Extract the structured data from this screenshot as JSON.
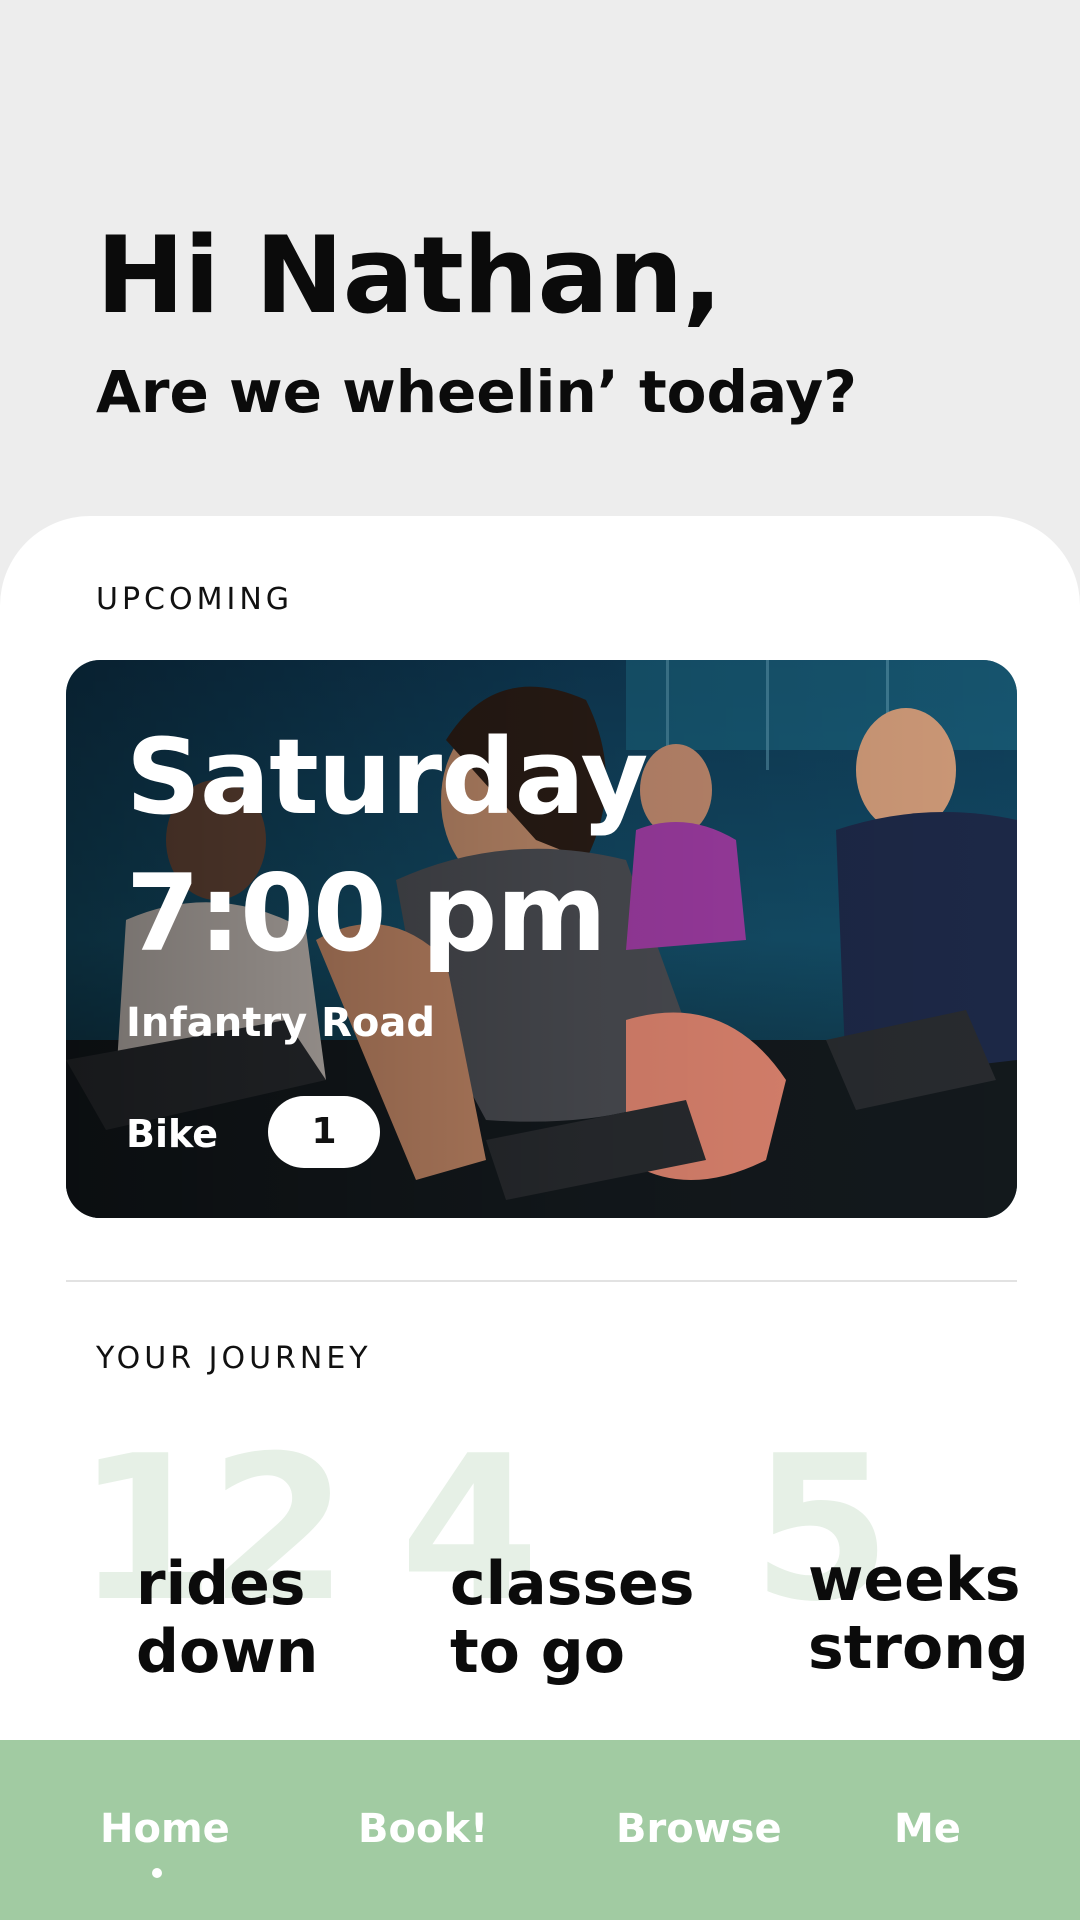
{
  "greeting": {
    "title": "Hi Nathan,",
    "subtitle": "Are we wheelin’ today?"
  },
  "upcoming": {
    "section_label": "UPCOMING",
    "day": "Saturday",
    "time": "7:00 pm",
    "location": "Infantry Road",
    "bike_label": "Bike",
    "bike_number": "1",
    "photo_icon": "spin-class-photo"
  },
  "journey": {
    "section_label": "YOUR  JOURNEY",
    "stats": [
      {
        "number": "12",
        "line1": "rides",
        "line2": "down"
      },
      {
        "number": "4",
        "line1": "classes",
        "line2": "to go"
      },
      {
        "number": "5",
        "line1": "weeks",
        "line2": "strong"
      }
    ]
  },
  "nav": {
    "items": [
      {
        "label": "Home",
        "active": true
      },
      {
        "label": "Book!",
        "active": false
      },
      {
        "label": "Browse",
        "active": false
      },
      {
        "label": "Me",
        "active": false
      }
    ]
  },
  "colors": {
    "background": "#ededed",
    "sheet": "#ffffff",
    "nav_background": "#a1cba2",
    "stat_number": "#e6f0e6",
    "text_primary": "#0b0b0b"
  }
}
